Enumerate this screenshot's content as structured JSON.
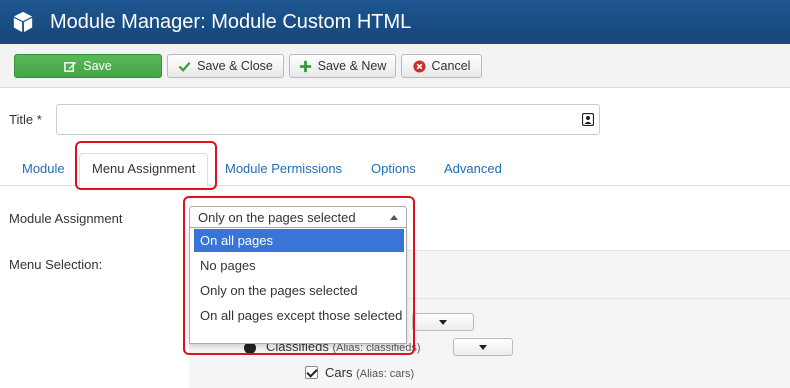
{
  "header": {
    "title": "Module Manager: Module Custom HTML",
    "icon": "cube-icon"
  },
  "toolbar": {
    "save_label": "Save",
    "save_close_label": "Save & Close",
    "save_new_label": "Save & New",
    "cancel_label": "Cancel"
  },
  "form": {
    "title_label": "Title *",
    "title_value": ""
  },
  "tabs": [
    {
      "label": "Module"
    },
    {
      "label": "Menu Assignment"
    },
    {
      "label": "Module Permissions"
    },
    {
      "label": "Options"
    },
    {
      "label": "Advanced"
    }
  ],
  "assignment": {
    "label": "Module Assignment",
    "selected": "Only on the pages selected",
    "options": [
      "On all pages",
      "No pages",
      "Only on the pages selected",
      "On all pages except those selected"
    ],
    "highlighted_option": "On all pages"
  },
  "menu_selection": {
    "label": "Menu Selection:",
    "items": [
      {
        "name": "Classifieds",
        "alias": "(Alias: classifieds)"
      },
      {
        "name": "Cars",
        "alias": "(Alias: cars)",
        "checked": true
      }
    ]
  },
  "colors": {
    "header_bg": "#17467a",
    "save_button": "#44a444",
    "link": "#1f6fb5",
    "highlight_border": "#e0101a",
    "selected_option": "#3875d7"
  }
}
